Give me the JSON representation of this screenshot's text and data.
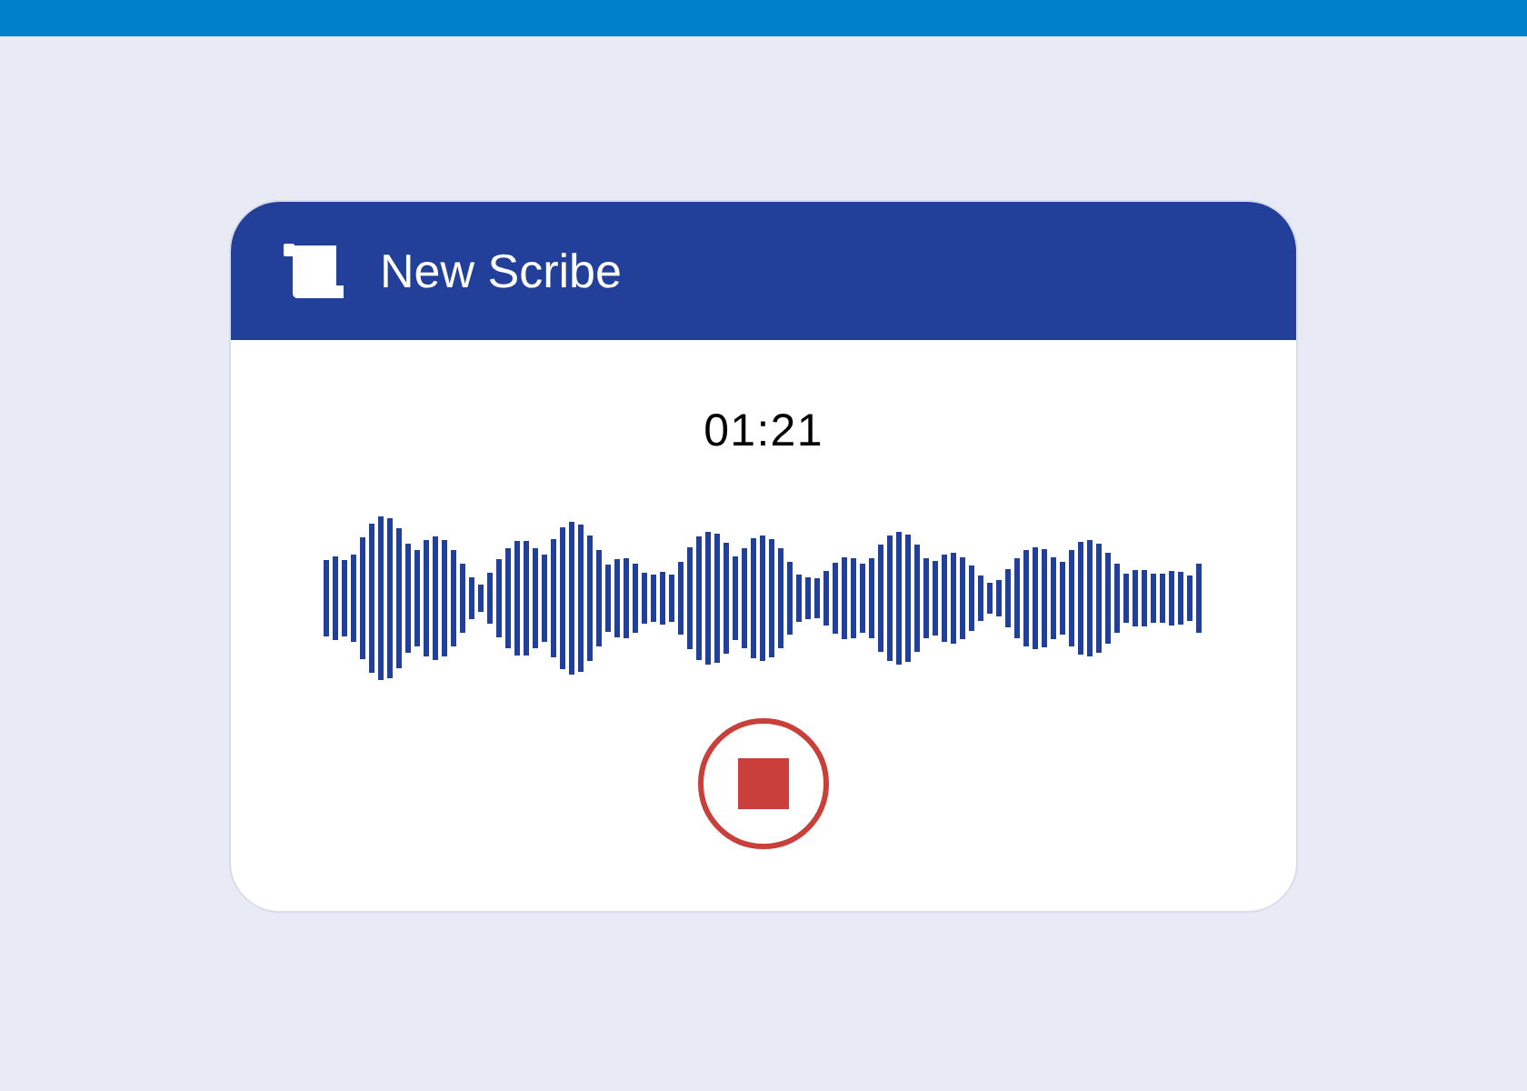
{
  "card": {
    "title": "New Scribe",
    "timer": "01:21"
  }
}
